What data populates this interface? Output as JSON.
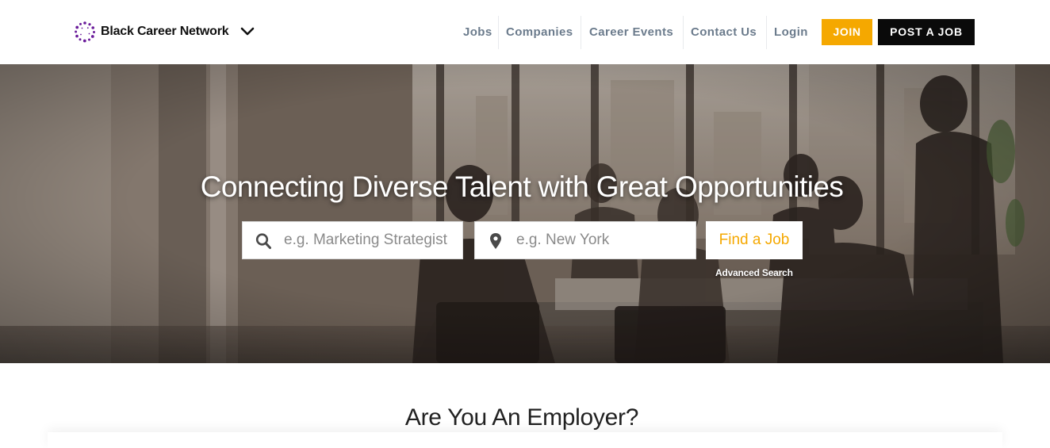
{
  "header": {
    "logo": {
      "name": "Black Career Network",
      "icon": "dotted-ring-logo",
      "dropdown_icon": "chevron-down-icon"
    },
    "nav": [
      {
        "label": "Jobs"
      },
      {
        "label": "Companies"
      },
      {
        "label": "Career Events"
      },
      {
        "label": "Contact Us"
      },
      {
        "label": "Login"
      }
    ],
    "join_label": "JOIN",
    "post_job_label": "POST A JOB"
  },
  "hero": {
    "title": "Connecting Diverse Talent with Great Opportunities",
    "keyword_placeholder": "e.g. Marketing Strategist",
    "location_placeholder": "e.g. New York",
    "find_button": "Find a Job",
    "advanced_search": "Advanced Search",
    "search_icon": "search-icon",
    "location_icon": "map-pin-icon"
  },
  "employer_section": {
    "heading": "Are You An Employer?"
  },
  "colors": {
    "accent": "#f5a800",
    "nav_text": "#6b7b8c",
    "post_button": "#0a0a0a",
    "logo_purple": "#6a1b9a"
  }
}
